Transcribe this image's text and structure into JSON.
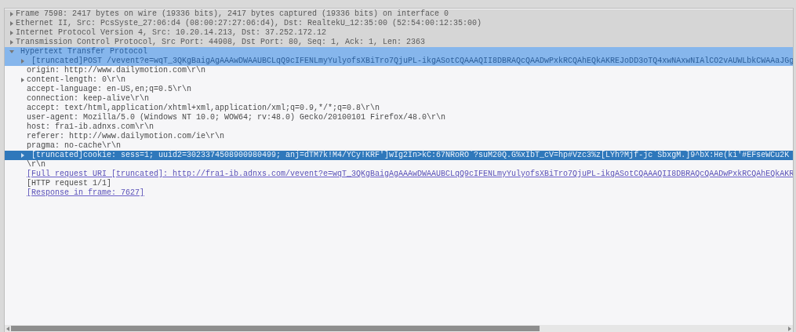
{
  "tree": [
    {
      "text": "Frame 7598: 2417 bytes on wire (19336 bits), 2417 bytes captured (19336 bits) on interface 0",
      "kind": "field",
      "expanded": false,
      "shaded": true,
      "highlighted": false,
      "selected": false
    },
    {
      "text": "Ethernet II, Src: PcsSyste_27:06:d4 (08:00:27:27:06:d4), Dst: RealtekU_12:35:00 (52:54:00:12:35:00)",
      "kind": "field",
      "expanded": false,
      "shaded": true,
      "highlighted": false,
      "selected": false
    },
    {
      "text": "Internet Protocol Version 4, Src: 10.20.14.213, Dst: 37.252.172.12",
      "kind": "field",
      "expanded": false,
      "shaded": true,
      "highlighted": false,
      "selected": false
    },
    {
      "text": "Transmission Control Protocol, Src Port: 44908, Dst Port: 80, Seq: 1, Ack: 1, Len: 2363",
      "kind": "field",
      "expanded": false,
      "shaded": true,
      "highlighted": false,
      "selected": false
    },
    {
      "text": "Hypertext Transfer Protocol",
      "kind": "field",
      "expanded": true,
      "shaded": false,
      "highlighted": true,
      "selected": false,
      "children": [
        {
          "text": "[truncated]POST /vevent?e=wqT_3QKgBaigAgAAAwDWAAUBCLqQ9cIFENLmyYulyofsXBiTro7QjuPL-ikgASotCQAAAQII8DBRAQcQAADwPxkRCQAhEQkAKREJoDD3oTQ4xwNAxwNIAlCO2vAUWLbkCWAAaJGg",
          "kind": "field",
          "expanded": false,
          "highlighted": true,
          "selected": false
        },
        {
          "text": "origin: http://www.dailymotion.com\\r\\n",
          "kind": "field",
          "highlighted": false,
          "selected": false
        },
        {
          "text": "content-length: 0\\r\\n",
          "kind": "field",
          "expanded": false,
          "highlighted": false,
          "selected": false
        },
        {
          "text": "accept-language: en-US,en;q=0.5\\r\\n",
          "kind": "field",
          "highlighted": false,
          "selected": false
        },
        {
          "text": "connection: keep-alive\\r\\n",
          "kind": "field",
          "highlighted": false,
          "selected": false
        },
        {
          "text": "accept: text/html,application/xhtml+xml,application/xml;q=0.9,*/*;q=0.8\\r\\n",
          "kind": "field",
          "highlighted": false,
          "selected": false
        },
        {
          "text": "user-agent: Mozilla/5.0 (Windows NT 10.0; WOW64; rv:48.0) Gecko/20100101 Firefox/48.0\\r\\n",
          "kind": "field",
          "highlighted": false,
          "selected": false
        },
        {
          "text": "host: fra1-ib.adnxs.com\\r\\n",
          "kind": "field",
          "highlighted": false,
          "selected": false
        },
        {
          "text": "referer: http://www.dailymotion.com/ie\\r\\n",
          "kind": "field",
          "highlighted": false,
          "selected": false
        },
        {
          "text": "pragma: no-cache\\r\\n",
          "kind": "field",
          "highlighted": false,
          "selected": false
        },
        {
          "text": "[truncated]cookie: sess=1; uuid2=3023374508900980499; anj=dTM7k!M4/YCy!KRF']wIg2In>kC:67NRoRO`?suM20Q.G%xIbT_cV=hp#Vzc3%z[LYh?Mjf-jc`SbxgM.]9^bX:He(ki'#EFseWCu2K",
          "kind": "field",
          "expanded": false,
          "highlighted": false,
          "selected": true
        },
        {
          "text": "\\r\\n",
          "kind": "field",
          "highlighted": false,
          "selected": false
        },
        {
          "text": "[Full request URI [truncated]: http://fra1-ib.adnxs.com/vevent?e=wqT_3QKgBaigAgAAAwDWAAUBCLqQ9cIFENLmyYulyofsXBiTro7QjuPL-ikgASotCQAAAQII8DBRAQcQAADwPxkRCQAhEQkAKR",
          "kind": "link",
          "highlighted": false,
          "selected": false
        },
        {
          "text": "[HTTP request 1/1]",
          "kind": "field",
          "highlighted": false,
          "selected": false
        },
        {
          "text": "[Response in frame: 7627]",
          "kind": "link",
          "highlighted": false,
          "selected": false
        }
      ]
    }
  ]
}
